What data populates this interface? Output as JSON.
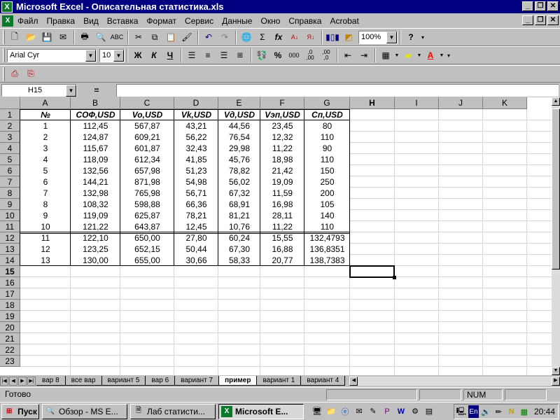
{
  "window": {
    "title": "Microsoft Excel - Описательная статистика.xls"
  },
  "menu": [
    "Файл",
    "Правка",
    "Вид",
    "Вставка",
    "Формат",
    "Сервис",
    "Данные",
    "Окно",
    "Справка",
    "Acrobat"
  ],
  "toolbar": {
    "zoom": "100%",
    "font_name": "Arial Cyr",
    "font_size": "10",
    "bold": "Ж",
    "italic": "К",
    "underline": "Ч",
    "percent": "%",
    "thousands": "000",
    "inc_decimal": ",0\n,00",
    "dec_decimal": ",00\n,0",
    "sigma": "Σ",
    "fx": "fx"
  },
  "formula": {
    "name_box": "H15",
    "eq": "=",
    "value": ""
  },
  "columns": [
    "A",
    "B",
    "C",
    "D",
    "E",
    "F",
    "G",
    "H",
    "I",
    "J",
    "K"
  ],
  "rows": [
    "1",
    "2",
    "3",
    "4",
    "5",
    "6",
    "7",
    "8",
    "9",
    "10",
    "11",
    "12",
    "13",
    "14",
    "15",
    "16",
    "17",
    "18",
    "19",
    "20",
    "21",
    "22",
    "23"
  ],
  "headers": [
    "№",
    "СОФ,USD",
    "Vo,USD",
    "Vk,USD",
    "Vд,USD",
    "Vэп,USD",
    "Cп,USD"
  ],
  "table": [
    [
      "1",
      "112,45",
      "567,87",
      "43,21",
      "44,56",
      "23,45",
      "80"
    ],
    [
      "2",
      "124,87",
      "609,21",
      "56,22",
      "76,54",
      "12,32",
      "110"
    ],
    [
      "3",
      "115,67",
      "601,87",
      "32,43",
      "29,98",
      "11,22",
      "90"
    ],
    [
      "4",
      "118,09",
      "612,34",
      "41,85",
      "45,76",
      "18,98",
      "110"
    ],
    [
      "5",
      "132,56",
      "657,98",
      "51,23",
      "78,82",
      "21,42",
      "150"
    ],
    [
      "6",
      "144,21",
      "871,98",
      "54,98",
      "56,02",
      "19,09",
      "250"
    ],
    [
      "7",
      "132,98",
      "765,98",
      "56,71",
      "67,32",
      "11,59",
      "200"
    ],
    [
      "8",
      "108,32",
      "598,88",
      "66,36",
      "68,91",
      "16,98",
      "105"
    ],
    [
      "9",
      "119,09",
      "625,87",
      "78,21",
      "81,21",
      "28,11",
      "140"
    ],
    [
      "10",
      "121,22",
      "643,87",
      "12,45",
      "10,76",
      "11,22",
      "110"
    ],
    [
      "11",
      "122,10",
      "650,00",
      "27,80",
      "60,24",
      "15,55",
      "132,4793"
    ],
    [
      "12",
      "123,25",
      "652,15",
      "50,44",
      "67,30",
      "16,88",
      "136,8351"
    ],
    [
      "13",
      "130,00",
      "655,00",
      "30,66",
      "58,33",
      "20,77",
      "138,7383"
    ]
  ],
  "sheets": [
    "вар 8",
    "все вар",
    "вариант 5",
    "вар 6",
    "вариант 7",
    "пример",
    "вариант 1",
    "вариант 4"
  ],
  "active_sheet": "пример",
  "status": {
    "ready": "Готово",
    "num": "NUM"
  },
  "taskbar": {
    "start": "Пуск",
    "tasks": [
      "Обзор - MS E...",
      "Лаб статисти...",
      "Microsoft E..."
    ],
    "active_task": 2,
    "clock": "20:44",
    "lang": "En"
  }
}
